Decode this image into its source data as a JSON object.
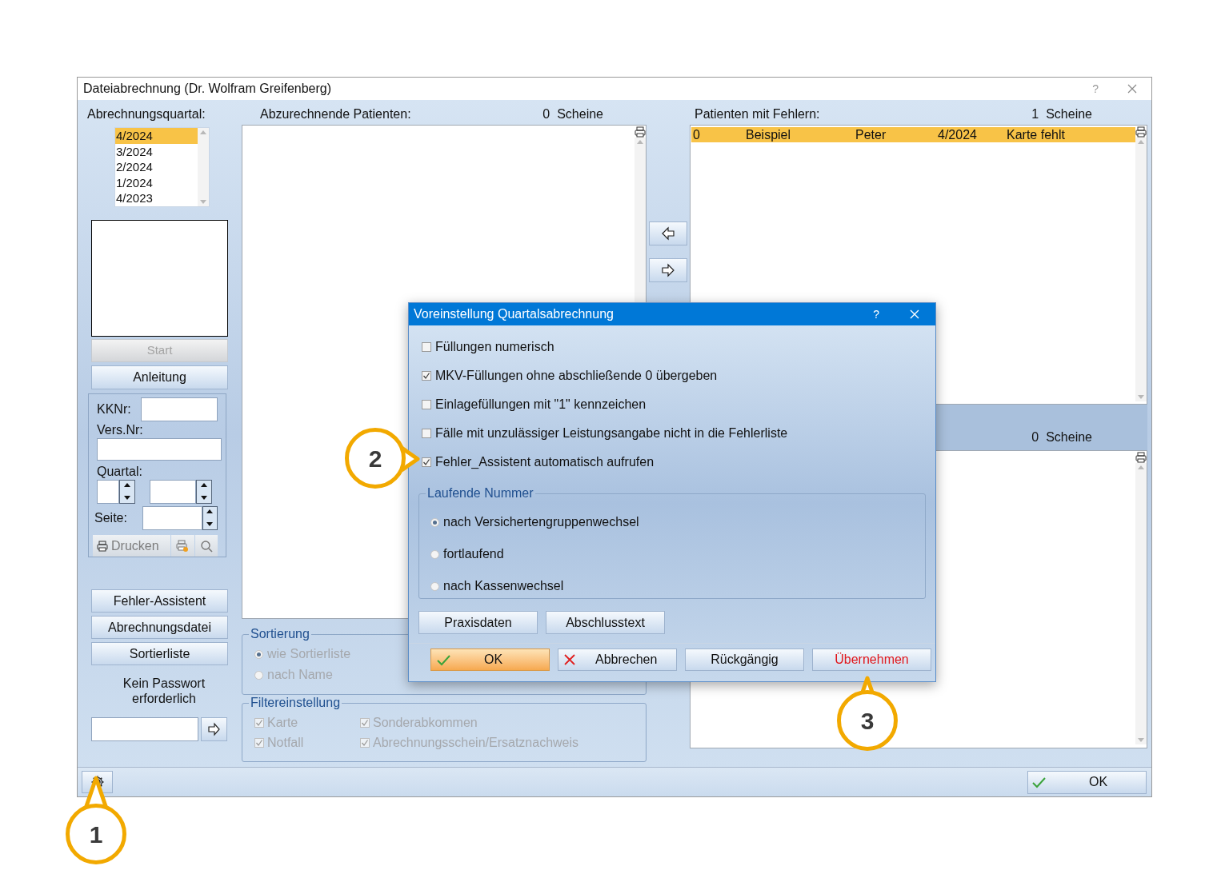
{
  "window": {
    "title": "Dateiabrechnung (Dr. Wolfram Greifenberg)",
    "help": "?"
  },
  "quarter_panel": {
    "label": "Abrechnungsquartal:",
    "quarters": [
      {
        "label": "4/2024",
        "selected": true
      },
      {
        "label": "3/2024",
        "selected": false
      },
      {
        "label": "2/2024",
        "selected": false
      },
      {
        "label": "1/2024",
        "selected": false
      },
      {
        "label": "4/2023",
        "selected": false
      }
    ]
  },
  "start_button": {
    "label": "Start",
    "disabled": true
  },
  "guide_button": "Anleitung",
  "search_group": {
    "kknr_label": "KKNr:",
    "versnr_label": "Vers.Nr:",
    "quartal_label": "Quartal:",
    "seite_label": "Seite:",
    "print_button": "Drucken"
  },
  "side_buttons": [
    "Fehler-Assistent",
    "Abrechnungsdatei",
    "Sortierliste"
  ],
  "password_note": "Kein Passwort erforderlich",
  "pending": {
    "label": "Abzurechnende Patienten:",
    "count": "0",
    "unit": "Scheine"
  },
  "sorting": {
    "title": "Sortierung",
    "disabled": true,
    "options": [
      {
        "label": "wie Sortierliste",
        "selected": true
      },
      {
        "label": "nach Name",
        "selected": false
      }
    ]
  },
  "filter": {
    "title": "Filtereinstellung",
    "disabled": true,
    "options": [
      {
        "label": "Karte",
        "checked": true
      },
      {
        "label": "Sonderabkommen",
        "checked": true
      },
      {
        "label": "Notfall",
        "checked": true
      },
      {
        "label": "Abrechnungsschein/Ersatznachweis",
        "checked": true
      }
    ]
  },
  "errors": {
    "label": "Patienten mit Fehlern:",
    "count": "1",
    "unit": "Scheine",
    "rows": [
      {
        "cells": [
          "0",
          "Beispiel",
          "Peter",
          "4/2024",
          "Karte fehlt"
        ],
        "selected": true
      }
    ]
  },
  "second_list": {
    "count": "0",
    "unit": "Scheine"
  },
  "ok_button": "OK",
  "dialog": {
    "title": "Voreinstellung Quartalsabrechnung",
    "help": "?",
    "options": [
      {
        "label": "Füllungen numerisch",
        "checked": false
      },
      {
        "label": "MKV-Füllungen ohne abschließende 0 übergeben",
        "checked": true
      },
      {
        "label": "Einlagefüllungen mit \"1\" kennzeichen",
        "checked": false
      },
      {
        "label": "Fälle mit unzulässiger Leistungsangabe nicht in die Fehlerliste",
        "checked": false
      },
      {
        "label": "Fehler_Assistent automatisch aufrufen",
        "checked": true
      }
    ],
    "numbering": {
      "title": "Laufende Nummer",
      "options": [
        {
          "label": "nach Versichertengruppenwechsel",
          "selected": true
        },
        {
          "label": "fortlaufend",
          "selected": false
        },
        {
          "label": "nach Kassenwechsel",
          "selected": false
        }
      ]
    },
    "extra_buttons": [
      "Praxisdaten",
      "Abschlusstext"
    ],
    "buttons": [
      {
        "label": "OK",
        "kind": "ok"
      },
      {
        "label": "Abbrechen",
        "kind": "cancel"
      },
      {
        "label": "Rückgängig",
        "kind": "plain"
      },
      {
        "label": "Übernehmen",
        "kind": "apply"
      }
    ]
  },
  "callouts": [
    {
      "label": "1",
      "kind": "up"
    },
    {
      "label": "2",
      "kind": "right"
    },
    {
      "label": "3",
      "kind": "up"
    }
  ]
}
